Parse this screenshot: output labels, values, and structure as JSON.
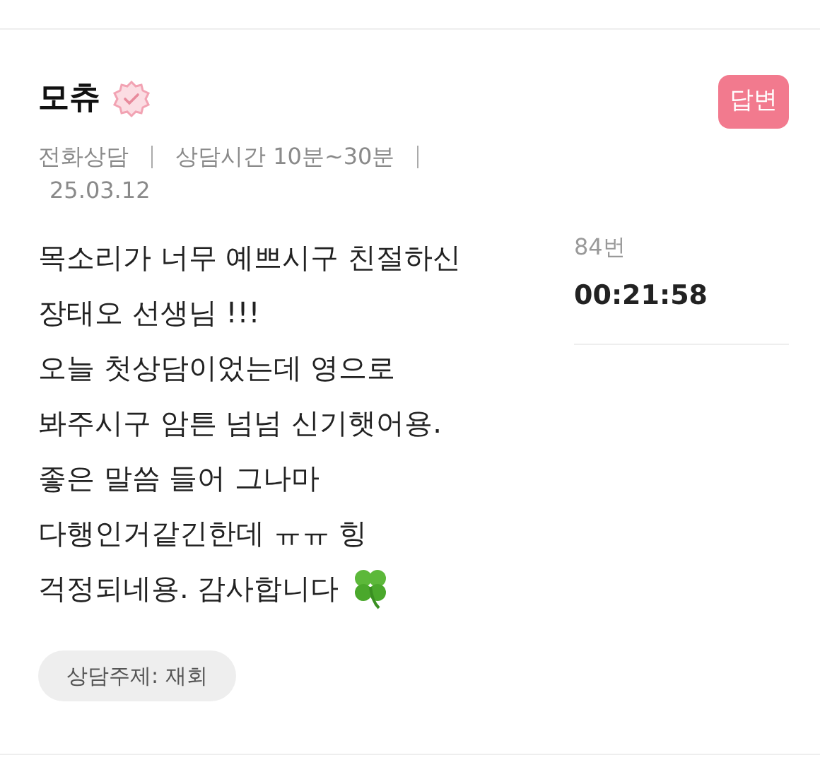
{
  "review": {
    "author": "모츄",
    "verified": true,
    "reply_badge": "답변",
    "meta": [
      "전화상담",
      "상담시간 10분~30분"
    ],
    "date": "25.03.12",
    "lines": [
      "목소리가 너무 예쁘시구 친절하신",
      "장태오 선생님 !!!",
      "오늘 첫상담이었는데 영으로",
      "봐주시구 암튼 넘넘 신기햇어용.",
      "좋은 말씀 들어 그나마",
      "다행인거같긴한데 ㅠㅠ 힝",
      "걱정되네용. 감사합니다"
    ],
    "topic": "상담주제: 재회"
  },
  "side": {
    "number": "84번",
    "duration": "00:21:58"
  }
}
